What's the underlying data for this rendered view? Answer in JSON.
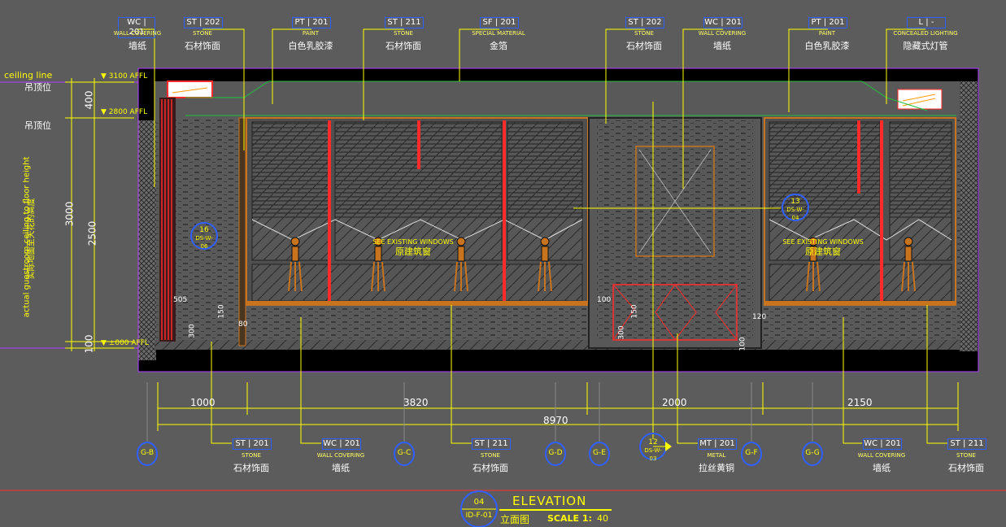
{
  "top_tags": [
    {
      "code": "WC",
      "num": "201",
      "en": "WALL COVERING",
      "cn": "墙纸"
    },
    {
      "code": "ST",
      "num": "202",
      "en": "STONE",
      "cn": "石材饰面"
    },
    {
      "code": "PT",
      "num": "201",
      "en": "PAINT",
      "cn": "白色乳胶漆"
    },
    {
      "code": "ST",
      "num": "211",
      "en": "STONE",
      "cn": "石材饰面"
    },
    {
      "code": "SF",
      "num": "201",
      "en": "SPECIAL MATERIAL",
      "cn": "金箔"
    },
    {
      "code": "ST",
      "num": "202",
      "en": "STONE",
      "cn": "石材饰面"
    },
    {
      "code": "WC",
      "num": "201",
      "en": "WALL COVERING",
      "cn": "墙纸"
    },
    {
      "code": "PT",
      "num": "201",
      "en": "PAINT",
      "cn": "白色乳胶漆"
    },
    {
      "code": "L",
      "num": "-",
      "en": "CONCEALED LIGHTING",
      "cn": "隐藏式灯管"
    }
  ],
  "bottom_tags": [
    {
      "code": "ST",
      "num": "201",
      "en": "STONE",
      "cn": "石材饰面"
    },
    {
      "code": "WC",
      "num": "201",
      "en": "WALL COVERING",
      "cn": "墙纸"
    },
    {
      "code": "ST",
      "num": "211",
      "en": "STONE",
      "cn": "石材饰面"
    },
    {
      "code": "MT",
      "num": "201",
      "en": "METAL",
      "cn": "拉丝黄铜"
    },
    {
      "code": "WC",
      "num": "201",
      "en": "WALL COVERING",
      "cn": "墙纸"
    },
    {
      "code": "ST",
      "num": "211",
      "en": "STONE",
      "cn": "石材饰面"
    }
  ],
  "left_labels": {
    "ceiling_line": "ceiling line",
    "ceiling_cn_1": "吊顶位",
    "ceiling_cn_2": "吊顶位",
    "vertical_en": "actual guestroom ceiling to floor height",
    "vertical_cn": "实际地面至天花的高度"
  },
  "levels": {
    "top": "3100 AFFL",
    "mid": "2800 AFFL",
    "bottom": "±000 AFFL"
  },
  "vertical_dims": {
    "d400": "400",
    "d3000": "3000",
    "d2500": "2500",
    "d100": "100"
  },
  "small_dims": {
    "d505": "505",
    "d300a": "300",
    "d80": "80",
    "d150a": "150",
    "d100a": "100",
    "d150b": "150",
    "d300b": "300",
    "d120": "120",
    "d100b": "100"
  },
  "horizontal_dims": {
    "d1000": "1000",
    "d3820": "3820",
    "d2000": "2000",
    "d2150": "2150",
    "total": "8970"
  },
  "grid_bubbles": [
    "G-B",
    "G-C",
    "G-D",
    "G-E",
    "G-F",
    "G-G"
  ],
  "section_markers": [
    {
      "num": "16",
      "ref": "DS-W-06"
    },
    {
      "num": "13",
      "ref": "DS-W-04"
    },
    {
      "num": "12",
      "ref": "DS-W-03"
    }
  ],
  "window_notes": [
    {
      "en": "SEE EXISTING WINDOWS",
      "cn": "原建筑窗"
    },
    {
      "en": "SEE EXISTING WINDOWS",
      "cn": "原建筑窗"
    }
  ],
  "title": {
    "num": "04",
    "ref": "ID-F-01",
    "heading": "ELEVATION",
    "cn": "立面图",
    "scale_label": "SCALE 1:",
    "scale_value": "40"
  },
  "colors": {
    "background": "#5c5c5c",
    "annotation": "#ffff00",
    "frame": "#000000",
    "accent_red": "#ff2a2a",
    "accent_orange": "#c8741e",
    "tag_border": "#1e5cff"
  }
}
